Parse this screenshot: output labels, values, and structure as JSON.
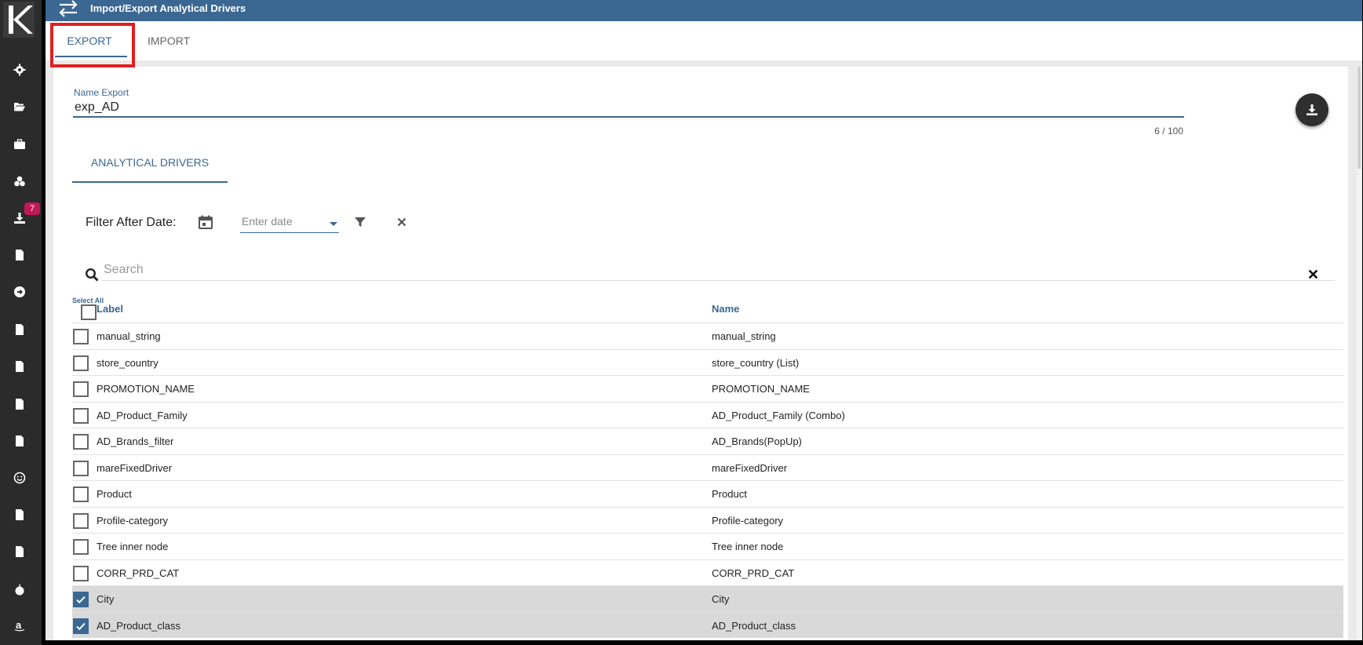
{
  "header": {
    "title": "Import/Export Analytical Drivers"
  },
  "sidebar": {
    "download_badge": "7"
  },
  "tabs": {
    "export": "EXPORT",
    "import": "IMPORT"
  },
  "export_form": {
    "name_label": "Name Export",
    "name_value": "exp_AD",
    "counter": "6 / 100"
  },
  "sub_tabs": {
    "analytical_drivers": "ANALYTICAL DRIVERS"
  },
  "filter": {
    "label": "Filter After Date:",
    "date_placeholder": "Enter date"
  },
  "search": {
    "placeholder": "Search"
  },
  "table": {
    "select_all": "Select All",
    "columns": {
      "label": "Label",
      "name": "Name"
    },
    "rows": [
      {
        "label": "manual_string",
        "name": "manual_string",
        "checked": false
      },
      {
        "label": "store_country",
        "name": "store_country (List)",
        "checked": false
      },
      {
        "label": "PROMOTION_NAME",
        "name": "PROMOTION_NAME",
        "checked": false
      },
      {
        "label": "AD_Product_Family",
        "name": "AD_Product_Family (Combo)",
        "checked": false
      },
      {
        "label": "AD_Brands_filter",
        "name": "AD_Brands(PopUp)",
        "checked": false
      },
      {
        "label": "mareFixedDriver",
        "name": "mareFixedDriver",
        "checked": false
      },
      {
        "label": "Product",
        "name": "Product",
        "checked": false
      },
      {
        "label": "Profile-category",
        "name": "Profile-category",
        "checked": false
      },
      {
        "label": "Tree inner node",
        "name": "Tree inner node",
        "checked": false
      },
      {
        "label": "CORR_PRD_CAT",
        "name": "CORR_PRD_CAT",
        "checked": false
      },
      {
        "label": "City",
        "name": "City",
        "checked": true
      },
      {
        "label": "AD_Product_class",
        "name": "AD_Product_class",
        "checked": true
      }
    ]
  }
}
